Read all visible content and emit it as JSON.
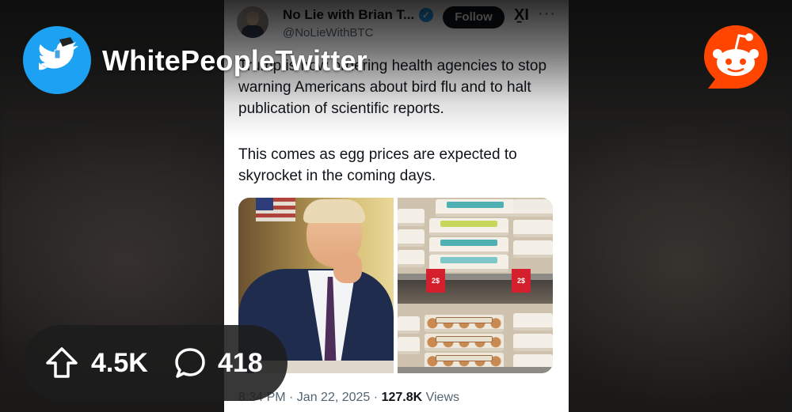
{
  "subreddit": {
    "name": "WhitePeopleTwitter",
    "icon": "twitter-bird-icon",
    "brand_icon": "reddit-snoo-icon",
    "brand_color": "#ff4500",
    "icon_color": "#1da1f2"
  },
  "stats": {
    "upvotes": "4.5K",
    "comments": "418",
    "upvote_icon": "upvote-arrow-icon",
    "comment_icon": "comment-bubble-icon"
  },
  "tweet": {
    "author_name": "No Lie with Brian T...",
    "handle": "@NoLieWithBTC",
    "verified": true,
    "follow_label": "Follow",
    "x_logo": "X̱I",
    "more_label": "···",
    "paragraph_1": "Trump is now ordering health agencies to stop warning Americans about bird flu and to halt publication of scientific reports.",
    "paragraph_2": "This comes as egg prices are expected to skyrocket in the coming days.",
    "media_alt": "Photo of Trump with hand on chin beside photo of egg cartons on store shelves",
    "timestamp": "8:34 PM · Jan 22, 2025 ·",
    "views_count": "127.8K",
    "views_label": "Views"
  }
}
